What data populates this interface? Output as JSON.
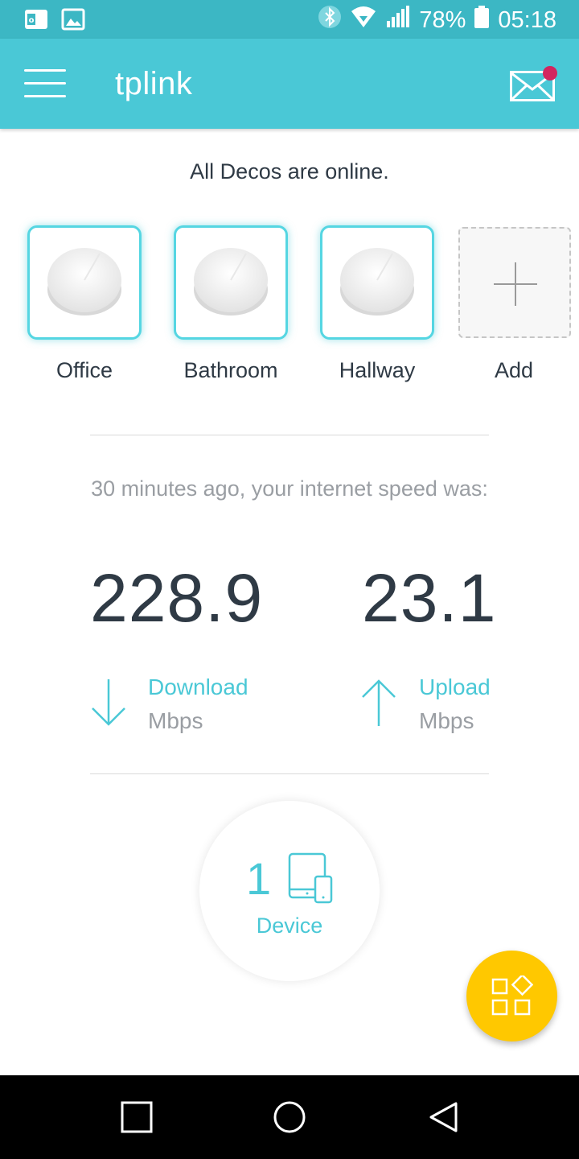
{
  "status_bar": {
    "battery": "78%",
    "time": "05:18",
    "icons": [
      "outlook-icon",
      "gallery-icon",
      "bluetooth-icon",
      "wifi-icon",
      "signal-icon",
      "battery-icon"
    ]
  },
  "app_bar": {
    "title": "tplink",
    "menu_icon": "hamburger-icon",
    "mail_icon": "mail-icon",
    "notification_color": "#d2255f"
  },
  "network_status": "All Decos are online.",
  "decos": [
    {
      "label": "Office"
    },
    {
      "label": "Bathroom"
    },
    {
      "label": "Hallway"
    }
  ],
  "add_label": "Add",
  "speed": {
    "caption": "30 minutes ago, your internet speed was:",
    "download": {
      "value": "228.9",
      "label": "Download",
      "unit": "Mbps"
    },
    "upload": {
      "value": "23.1",
      "label": "Upload",
      "unit": "Mbps"
    }
  },
  "devices": {
    "count": "1",
    "label": "Device"
  },
  "colors": {
    "accent": "#4ac8d6",
    "status_bar": "#3cb7c4",
    "fab": "#ffc800",
    "text": "#2f3a45"
  }
}
